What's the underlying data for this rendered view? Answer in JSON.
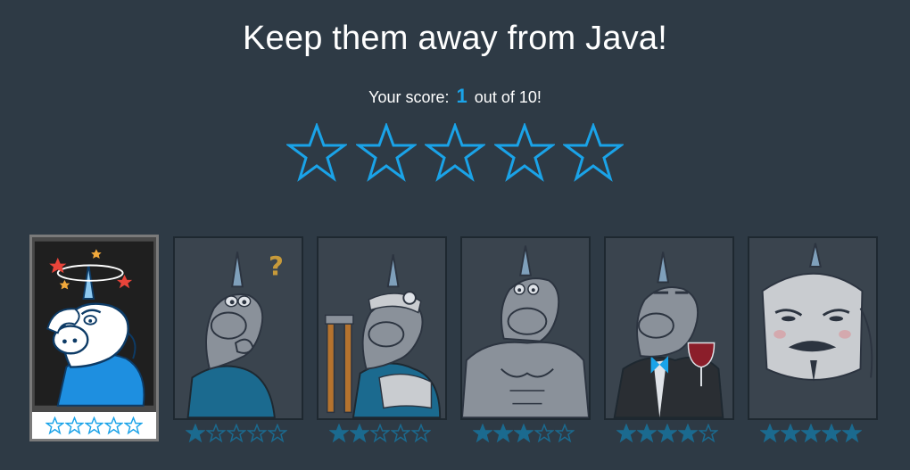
{
  "header": {
    "title": "Keep them away from Java!"
  },
  "score": {
    "prefix": "Your score:",
    "value": "1",
    "suffix": "out of 10!"
  },
  "rating": {
    "max": 5,
    "filled": 0
  },
  "colors": {
    "accent": "#1aa3e8",
    "background": "#2e3a45",
    "filled_star": "#1b6a8f"
  },
  "cards": [
    {
      "name": "dizzy-unicorn",
      "stars_filled": 0,
      "selected": true
    },
    {
      "name": "thinking-unicorn",
      "stars_filled": 1,
      "selected": false
    },
    {
      "name": "injured-unicorn",
      "stars_filled": 2,
      "selected": false
    },
    {
      "name": "muscle-unicorn",
      "stars_filled": 3,
      "selected": false
    },
    {
      "name": "tuxedo-unicorn",
      "stars_filled": 4,
      "selected": false
    },
    {
      "name": "masked-unicorn",
      "stars_filled": 5,
      "selected": false
    }
  ]
}
